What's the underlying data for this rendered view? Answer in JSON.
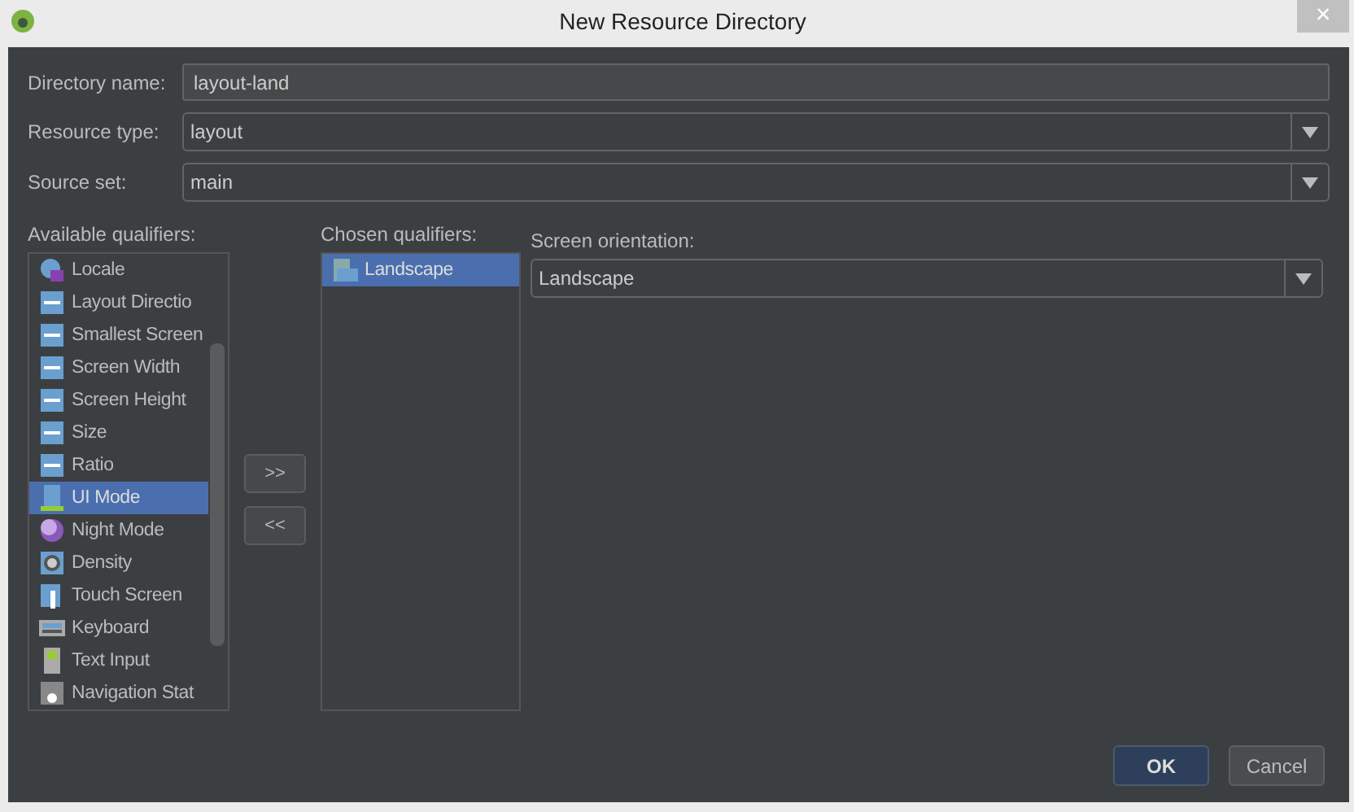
{
  "window": {
    "title": "New Resource Directory",
    "close": "×"
  },
  "fields": [
    {
      "label": "Directory name:",
      "value": "layout-land",
      "kind": "text"
    },
    {
      "label": "Resource type:",
      "value": "layout",
      "kind": "dropdown"
    },
    {
      "label": "Source set:",
      "value": "main",
      "kind": "dropdown"
    }
  ],
  "available_qualifiers": {
    "label": "Available qualifiers:",
    "items": [
      {
        "label": "Locale",
        "selected": false
      },
      {
        "label": "Layout Directio",
        "selected": false
      },
      {
        "label": "Smallest Screen",
        "selected": false
      },
      {
        "label": "Screen Width",
        "selected": false
      },
      {
        "label": "Screen Height",
        "selected": false
      },
      {
        "label": "Size",
        "selected": false
      },
      {
        "label": "Ratio",
        "selected": false
      },
      {
        "label": "UI Mode",
        "selected": true
      },
      {
        "label": "Night Mode",
        "selected": false
      },
      {
        "label": "Density",
        "selected": false
      },
      {
        "label": "Touch Screen",
        "selected": false
      },
      {
        "label": "Keyboard",
        "selected": false
      },
      {
        "label": "Text Input",
        "selected": false
      },
      {
        "label": "Navigation Stat",
        "selected": false
      }
    ]
  },
  "move_buttons": [
    ">>",
    "<<"
  ],
  "chosen_qualifiers": {
    "label": "Chosen qualifiers:",
    "items": [
      {
        "label": "Landscape",
        "selected": true
      }
    ]
  },
  "screen_orientation": {
    "label": "Screen orientation:",
    "value": "Landscape"
  },
  "buttons": [
    {
      "label": "OK",
      "kind": "default"
    },
    {
      "label": "Cancel",
      "kind": "normal"
    }
  ]
}
